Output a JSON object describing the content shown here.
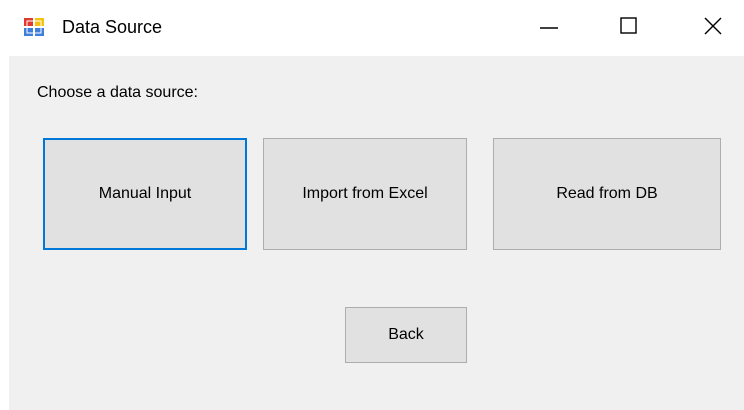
{
  "window": {
    "title": "Data Source",
    "icon": "form-app-icon",
    "controls": {
      "minimize_icon": "minimize-icon",
      "maximize_icon": "maximize-icon",
      "close_icon": "close-icon"
    }
  },
  "form": {
    "prompt": "Choose a data source:",
    "buttons": {
      "manual_input": "Manual Input",
      "import_excel": "Import from Excel",
      "read_db": "Read from DB",
      "back": "Back"
    },
    "focused_button": "Manual Input"
  },
  "colors": {
    "client_background": "#f0f0f0",
    "button_face": "#e1e1e1",
    "button_border": "#adadad",
    "focus_border": "#0078d7",
    "titlebar_background": "#ffffff"
  }
}
